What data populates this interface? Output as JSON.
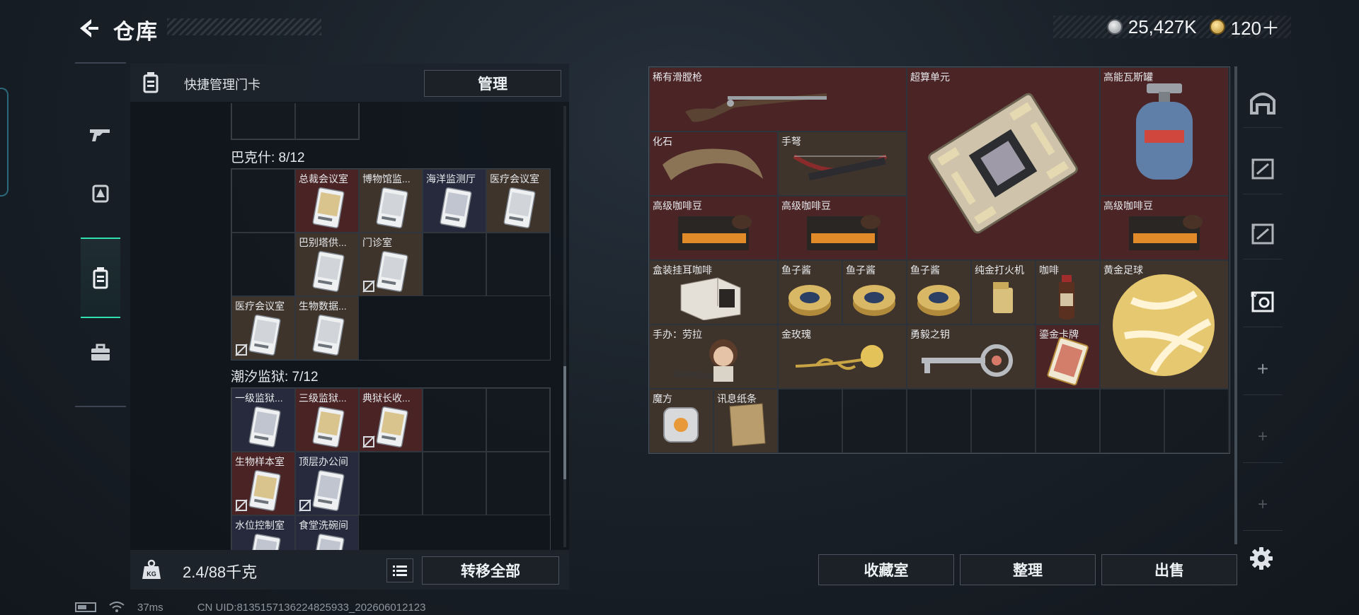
{
  "header": {
    "title": "仓库",
    "currency_silver": "25,427K",
    "currency_gold": "120＋"
  },
  "categories": [
    {
      "name": "weapons",
      "icon": "gun-icon"
    },
    {
      "name": "equipment",
      "icon": "backpack-icon"
    },
    {
      "name": "keycards",
      "icon": "keycard-icon",
      "active": true
    },
    {
      "name": "supplies",
      "icon": "toolbox-icon"
    }
  ],
  "left_panel": {
    "header_title": "快捷管理门卡",
    "manage_label": "管理",
    "groups": [
      {
        "title": "巴克什: 8/12",
        "cells": [
          {
            "label": "",
            "type": "empty"
          },
          {
            "label": "总裁会议室",
            "type": "card",
            "color": "red",
            "locked": false
          },
          {
            "label": "博物馆监...",
            "type": "card",
            "color": "brown",
            "locked": false
          },
          {
            "label": "海洋监测厅",
            "type": "card",
            "color": "navy",
            "locked": false
          },
          {
            "label": "医疗会议室",
            "type": "card",
            "color": "brown",
            "locked": false
          },
          {
            "label": "",
            "type": "empty"
          },
          {
            "label": "巴别塔供...",
            "type": "card",
            "color": "brown",
            "locked": false
          },
          {
            "label": "门诊室",
            "type": "card",
            "color": "brown",
            "locked": true
          },
          {
            "label": "",
            "type": "empty"
          },
          {
            "label": "",
            "type": "empty"
          },
          {
            "label": "医疗会议室",
            "type": "card",
            "color": "brown",
            "locked": true
          },
          {
            "label": "生物数据...",
            "type": "card",
            "color": "brown",
            "locked": false
          }
        ]
      },
      {
        "title": "潮汐监狱: 7/12",
        "cells": [
          {
            "label": "一级监狱...",
            "type": "card",
            "color": "navy",
            "locked": false
          },
          {
            "label": "三级监狱...",
            "type": "card",
            "color": "red",
            "locked": false
          },
          {
            "label": "典狱长收...",
            "type": "card",
            "color": "red",
            "locked": true
          },
          {
            "label": "",
            "type": "empty"
          },
          {
            "label": "",
            "type": "empty"
          },
          {
            "label": "生物样本室",
            "type": "card",
            "color": "red",
            "locked": true
          },
          {
            "label": "顶层办公间",
            "type": "card",
            "color": "navy",
            "locked": true
          },
          {
            "label": "",
            "type": "empty"
          },
          {
            "label": "",
            "type": "empty"
          },
          {
            "label": "",
            "type": "empty"
          },
          {
            "label": "水位控制室",
            "type": "card",
            "color": "navy",
            "locked": false
          },
          {
            "label": "食堂洗碗间",
            "type": "card",
            "color": "navy",
            "locked": false
          }
        ]
      }
    ],
    "weight": "2.4/88千克",
    "transfer_all_label": "转移全部"
  },
  "storage": {
    "items": [
      {
        "label": "稀有滑膛枪",
        "icon": "musket-icon",
        "color": "red"
      },
      {
        "label": "超算单元",
        "icon": "circuit-board-icon",
        "color": "red"
      },
      {
        "label": "高能瓦斯罐",
        "icon": "gas-tank-icon",
        "color": "red"
      },
      {
        "label": "化石",
        "icon": "fossil-claw-icon",
        "color": "red"
      },
      {
        "label": "手弩",
        "icon": "crossbow-icon",
        "color": "brown"
      },
      {
        "label": "高级咖啡豆",
        "icon": "coffee-bean-bag-icon",
        "color": "red"
      },
      {
        "label": "高级咖啡豆",
        "icon": "coffee-bean-bag-icon",
        "color": "red"
      },
      {
        "label": "高级咖啡豆",
        "icon": "coffee-bean-bag-icon",
        "color": "red"
      },
      {
        "label": "盒装挂耳咖啡",
        "icon": "coffee-box-icon",
        "color": "brown"
      },
      {
        "label": "鱼子酱",
        "icon": "caviar-tin-icon",
        "color": "brown"
      },
      {
        "label": "鱼子酱",
        "icon": "caviar-tin-icon",
        "color": "brown"
      },
      {
        "label": "鱼子酱",
        "icon": "caviar-tin-icon",
        "color": "brown"
      },
      {
        "label": "纯金打火机",
        "icon": "lighter-icon",
        "color": "brown"
      },
      {
        "label": "咖啡",
        "icon": "coffee-bottle-icon",
        "color": "brown"
      },
      {
        "label": "黄金足球",
        "icon": "golden-football-icon",
        "color": "brown"
      },
      {
        "label": "手办：劳拉",
        "icon": "figurine-icon",
        "color": "brown"
      },
      {
        "label": "金玫瑰",
        "icon": "golden-rose-icon",
        "color": "brown"
      },
      {
        "label": "勇毅之钥",
        "icon": "key-icon",
        "color": "brown"
      },
      {
        "label": "鎏金卡牌",
        "icon": "gilded-card-icon",
        "color": "red"
      },
      {
        "label": "魔方",
        "icon": "cube-icon",
        "color": "brown"
      },
      {
        "label": "讯息纸条",
        "icon": "paper-note-icon",
        "color": "brown"
      }
    ],
    "buttons": {
      "collection": "收藏室",
      "sort": "整理",
      "sell": "出售"
    }
  },
  "side_nav": [
    "vault-icon",
    "storage-1-icon",
    "storage-2-icon",
    "storage-4-icon"
  ],
  "status": {
    "ping": "37ms",
    "uid": "CN UID:8135157136224825933_202606012123"
  },
  "colors": {
    "accent": "#2fe0b0",
    "cell_red": "#4b2426",
    "cell_brown": "#3f342b",
    "cell_navy": "#272a3c"
  }
}
